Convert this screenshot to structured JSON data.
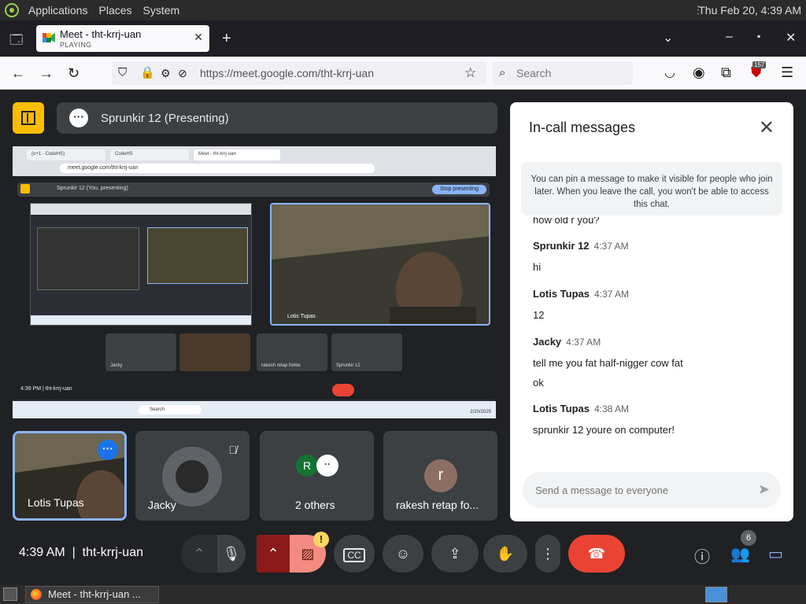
{
  "os": {
    "menu": [
      "Applications",
      "Places",
      "System"
    ],
    "clock": "Thu Feb 20, 4:39 AM"
  },
  "browser": {
    "tab_title": "Meet - tht-krrj-uan",
    "tab_status": "PLAYING",
    "url": "https://meet.google.com/tht-krrj-uan",
    "search_placeholder": "Search",
    "extension_badge": "157"
  },
  "meet": {
    "presenter_label": "Sprunkir 12 (Presenting)",
    "shared_screen": {
      "tabs": [
        "(o+1 - CodeHS)",
        "CodeHS",
        "Meet - tht-krrj-uan"
      ],
      "url": "meet.google.com/tht-krrj-uan",
      "presenting_label": "Sprunkir 12 (You, presenting)",
      "stop_label": "Stop presenting",
      "cam_label": "Lotis Tupas",
      "tiles": [
        "Jacky",
        "",
        "rakesh retap forkle",
        "Sprunkir 12"
      ],
      "time_code": "4:39 PM  |  tht-krrj-uan",
      "taskbar_search": "Search",
      "taskbar_date": "2/20/2025"
    },
    "tiles": [
      {
        "name": "Lotis Tupas"
      },
      {
        "name": "Jacky"
      },
      {
        "name": "2 others",
        "initial": "R"
      },
      {
        "name": "rakesh retap fo...",
        "initial": "r"
      }
    ]
  },
  "chat": {
    "title": "In-call messages",
    "pin_note": "You can pin a message to make it visible for people who join later. When you leave the call, you won't be able to access this chat.",
    "partial_top": "how old r you?",
    "messages": [
      {
        "author": "Sprunkir 12",
        "time": "4:37 AM",
        "lines": [
          "hi"
        ]
      },
      {
        "author": "Lotis Tupas",
        "time": "4:37 AM",
        "lines": [
          "12"
        ]
      },
      {
        "author": "Jacky",
        "time": "4:37 AM",
        "lines": [
          "tell me you fat half-nigger cow fat",
          "ok"
        ]
      },
      {
        "author": "Lotis Tupas",
        "time": "4:38 AM",
        "lines": [
          "sprunkir 12 youre on computer!"
        ]
      }
    ],
    "compose_placeholder": "Send a message to everyone"
  },
  "controls": {
    "time": "4:39 AM",
    "meeting_code": "tht-krrj-uan",
    "cam_warning": "!",
    "participants_count": "6"
  },
  "taskbar": {
    "task_label": "Meet - tht-krrj-uan ..."
  }
}
